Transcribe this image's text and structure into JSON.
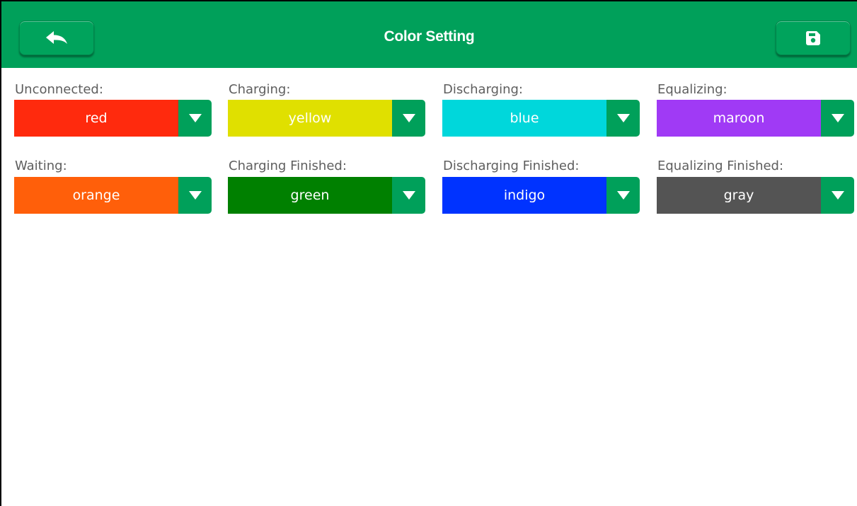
{
  "header": {
    "title": "Color Setting",
    "back_icon": "back-arrow-icon",
    "save_icon": "save-floppy-icon",
    "bg_color": "#00a05a"
  },
  "settings": [
    {
      "label": "Unconnected:",
      "value": "red",
      "color": "#ff2a0d"
    },
    {
      "label": "Charging:",
      "value": "yellow",
      "color": "#e0e000"
    },
    {
      "label": "Discharging:",
      "value": "blue",
      "color": "#00d7db"
    },
    {
      "label": "Equalizing:",
      "value": "maroon",
      "color": "#a03af5"
    },
    {
      "label": "Waiting:",
      "value": "orange",
      "color": "#ff5f0a"
    },
    {
      "label": "Charging Finished:",
      "value": "green",
      "color": "#008000"
    },
    {
      "label": "Discharging Finished:",
      "value": "indigo",
      "color": "#0033ff"
    },
    {
      "label": "Equalizing Finished:",
      "value": "gray",
      "color": "#545454"
    }
  ]
}
